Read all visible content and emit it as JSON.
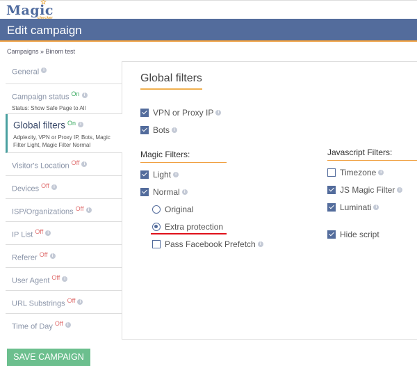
{
  "logo": {
    "text": "Magic",
    "sub": "checker"
  },
  "header": {
    "title": "Edit campaign"
  },
  "breadcrumb": "Campaigns » Binom test",
  "sidebar": {
    "items": [
      {
        "label": "General",
        "status": ""
      },
      {
        "label": "Campaign status",
        "status": "On",
        "desc": "Status: Show Safe Page to All"
      },
      {
        "label": "Global filters",
        "status": "On",
        "desc": "Adplexity, VPN or Proxy IP, Bots, Magic Filter Light, Magic Filter Normal"
      },
      {
        "label": "Visitor's Location",
        "status": "Off"
      },
      {
        "label": "Devices",
        "status": "Off"
      },
      {
        "label": "ISP/Organizations",
        "status": "Off"
      },
      {
        "label": "IP List",
        "status": "Off"
      },
      {
        "label": "Referer",
        "status": "Off"
      },
      {
        "label": "User Agent",
        "status": "Off"
      },
      {
        "label": "URL Substrings",
        "status": "Off"
      },
      {
        "label": "Time of Day",
        "status": "Off"
      }
    ]
  },
  "panel": {
    "title": "Global filters",
    "vpn": {
      "label": "VPN or Proxy IP",
      "checked": true
    },
    "bots": {
      "label": "Bots",
      "checked": true
    },
    "magic": {
      "title": "Magic Filters:",
      "light": {
        "label": "Light",
        "checked": true
      },
      "normal": {
        "label": "Normal",
        "checked": true
      },
      "original": {
        "label": "Original",
        "selected": false
      },
      "extra": {
        "label": "Extra protection",
        "selected": true
      },
      "facebook": {
        "label": "Pass Facebook Prefetch",
        "checked": false
      }
    },
    "js": {
      "title": "Javascript Filters:",
      "timezone": {
        "label": "Timezone",
        "checked": false
      },
      "jsmagic": {
        "label": "JS Magic Filter",
        "checked": true
      },
      "luminati": {
        "label": "Luminati",
        "checked": true
      },
      "hide": {
        "label": "Hide script",
        "checked": true
      }
    }
  },
  "save_label": "SAVE CAMPAIGN",
  "colors": {
    "header": "#536c9c",
    "accent": "#f0a040",
    "on": "#3aaa60",
    "off": "#e07070",
    "save": "#6cbf8e"
  }
}
